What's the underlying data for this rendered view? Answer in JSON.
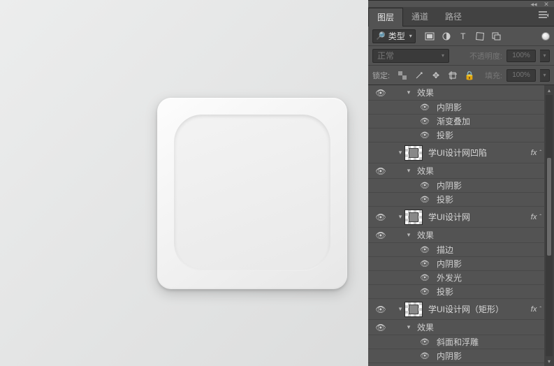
{
  "tabs": {
    "layers": "图层",
    "channels": "通道",
    "paths": "路径"
  },
  "filter": {
    "label": "类型"
  },
  "blend": {
    "mode": "正常",
    "opacity_label": "不透明度:",
    "opacity_value": "100%"
  },
  "lock": {
    "label": "锁定:",
    "fill_label": "填充:",
    "fill_value": "100%"
  },
  "fx_header": "效果",
  "fx_label": "fx",
  "fx": {
    "inner_shadow": "内阴影",
    "gradient_overlay": "渐变叠加",
    "drop_shadow": "投影",
    "stroke": "描边",
    "outer_glow": "外发光",
    "bevel": "斜面和浮雕"
  },
  "layers": {
    "l1": "学UI设计网凹陷",
    "l2": "学UI设计网",
    "l3": "学UI设计网（矩形）"
  }
}
